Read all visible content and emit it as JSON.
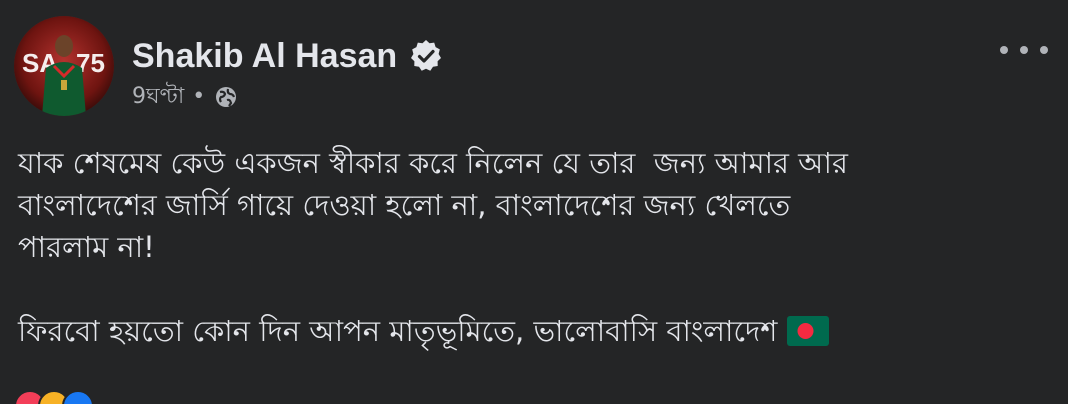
{
  "post": {
    "author_name": "Shakib Al Hasan",
    "verified": true,
    "time_text": "9ঘণ্টা",
    "separator": "•",
    "audience_icon": "globe-icon",
    "more_icon": "more-options-icon",
    "body_lines": [
      "যাক শেষমেষ কেউ একজন স্বীকার করে নিলেন যে তার  জন্য আমার আর",
      "বাংলাদেশের জার্সি গায়ে দেওয়া হলো না, বাংলাদেশের জন্য খেলতে",
      "পারলাম না!"
    ],
    "body_line_2": "ফিরবো হয়তো কোন দিন আপন মাতৃভূমিতে, ভালোবাসি বাংলাদেশ",
    "flag_icon": "bangladesh-flag-icon",
    "reaction_icons": [
      "love-icon",
      "haha-icon",
      "like-icon"
    ]
  },
  "colors": {
    "background": "#242526",
    "text_primary": "#e4e6eb",
    "text_secondary": "#b0b3b8",
    "flag_green": "#006a4e",
    "flag_red": "#f42a41"
  }
}
